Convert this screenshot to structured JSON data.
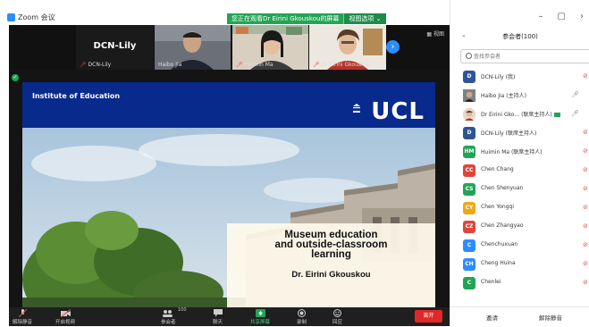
{
  "window": {
    "title": "Zoom 会议",
    "controls": [
      "–",
      "▢",
      "›"
    ]
  },
  "share_banner": {
    "text": "您正在观看Dr Eirini Gkouskou的屏幕",
    "view_options": "视图选项 ⌄"
  },
  "video_strip": {
    "tiles": [
      {
        "name": "DCN-Lily",
        "big_label": "DCN-Lily"
      },
      {
        "name": "Haibo Jia"
      },
      {
        "name": "Huimin Ma"
      },
      {
        "name": "Dr Eirini Gkouskou"
      }
    ],
    "gallery_label": "▦ 视图"
  },
  "slide": {
    "institute": "Institute of Education",
    "logo": "UCL",
    "caption_title": "Museum education\nand outside-classroom\nlearning",
    "caption_author": "Dr. Eirini Gkouskou"
  },
  "toolbar": {
    "mute": "解除静音",
    "video": "开启视频",
    "participants": "参会者",
    "participants_count": "100",
    "chat": "聊天",
    "share": "共享屏幕",
    "record": "录制",
    "reactions": "回应",
    "leave": "离开"
  },
  "panel": {
    "title": "参会者(100)",
    "search_placeholder": "查找参会者",
    "participants": [
      {
        "initials": "D",
        "name": "DCN-Lily (我)",
        "color": "#2f5597"
      },
      {
        "initials": "",
        "name": "Haibo Jia (主持人)",
        "color": "#8a6d5a",
        "photo": true
      },
      {
        "initials": "",
        "name": "Dr Eirini Gko... (联席主持人)",
        "color": "#c9a27a",
        "photo": true,
        "sharing": true
      },
      {
        "initials": "D",
        "name": "DCN-Lily (联席主持人)",
        "color": "#2f5597"
      },
      {
        "initials": "HM",
        "name": "Huimin Ma (联席主持人)",
        "color": "#23a455"
      },
      {
        "initials": "CC",
        "name": "Chen Chang",
        "color": "#e0453b"
      },
      {
        "initials": "CS",
        "name": "Chen Shenyuan",
        "color": "#23a455"
      },
      {
        "initials": "CY",
        "name": "Chen Yongqi",
        "color": "#f0a818"
      },
      {
        "initials": "CZ",
        "name": "Chen Zhangyao",
        "color": "#e0453b"
      },
      {
        "initials": "C",
        "name": "Chenchuxuan",
        "color": "#2d8cff"
      },
      {
        "initials": "CH",
        "name": "Cheng Huina",
        "color": "#2d8cff"
      },
      {
        "initials": "C",
        "name": "Chenlei",
        "color": "#23a455"
      }
    ],
    "footer": {
      "invite": "邀请",
      "unmute_all": "解除静音"
    }
  },
  "colors": {
    "zoom_blue": "#2d8cff",
    "share_green": "#23a455",
    "ucl_blue": "#082a8c",
    "leave_red": "#e02828"
  }
}
